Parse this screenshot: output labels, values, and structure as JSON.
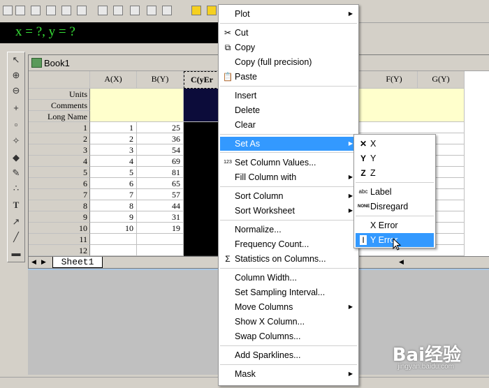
{
  "formula_bar": {
    "text": "x = ?, y = ?"
  },
  "workbook": {
    "title": "Book1",
    "columns": [
      "A(X)",
      "B(Y)",
      "C(yEr",
      "",
      "F(Y)",
      "G(Y)"
    ],
    "row_labels": [
      "Units",
      "Comments",
      "Long Name",
      "1",
      "2",
      "3",
      "4",
      "5",
      "6",
      "7",
      "8",
      "9",
      "10",
      "11",
      "12"
    ],
    "col_a": [
      "1",
      "2",
      "3",
      "4",
      "5",
      "6",
      "7",
      "8",
      "9",
      "10"
    ],
    "col_b": [
      "25",
      "36",
      "54",
      "69",
      "81",
      "65",
      "57",
      "44",
      "31",
      "19"
    ],
    "sheet_tab": "Sheet1"
  },
  "context_menu": {
    "items": {
      "plot": "Plot",
      "cut": "Cut",
      "copy": "Copy",
      "copy_full": "Copy (full precision)",
      "paste": "Paste",
      "insert": "Insert",
      "delete": "Delete",
      "clear": "Clear",
      "set_as": "Set As",
      "set_column_values": "Set Column Values...",
      "fill_column": "Fill Column with",
      "sort_column": "Sort Column",
      "sort_worksheet": "Sort Worksheet",
      "normalize": "Normalize...",
      "frequency_count": "Frequency Count...",
      "statistics": "Statistics on Columns...",
      "column_width": "Column Width...",
      "sampling_interval": "Set Sampling Interval...",
      "move_columns": "Move Columns",
      "show_x_column": "Show X Column...",
      "swap_columns": "Swap Columns...",
      "add_sparklines": "Add Sparklines...",
      "mask": "Mask"
    }
  },
  "set_as_submenu": {
    "x": "X",
    "y": "Y",
    "z": "Z",
    "label": "Label",
    "disregard": "Disregard",
    "x_error": "X Error",
    "y_error": "Y Error"
  },
  "icon_glyphs": {
    "set_values": "123",
    "none": "NONE",
    "abc": "abc",
    "sigma": "Σ"
  },
  "watermark": {
    "text": "Bai经验",
    "url": "jingyan.baidu.com"
  },
  "colors": {
    "highlight": "#3399ff",
    "meta_row": "#ffffcc",
    "formula_text": "#36e036"
  }
}
